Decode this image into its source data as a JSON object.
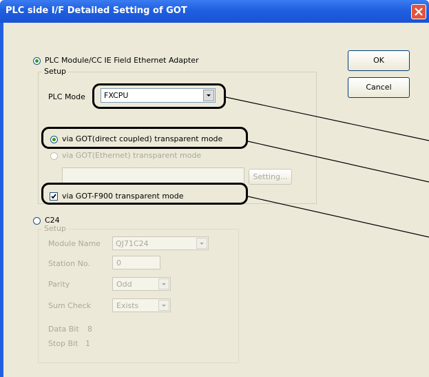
{
  "window": {
    "title": "PLC side I/F Detailed Setting of GOT"
  },
  "buttons": {
    "ok": "OK",
    "cancel": "Cancel"
  },
  "plc_module": {
    "radio_label": "PLC Module/CC IE Field Ethernet Adapter",
    "setup_label": "Setup",
    "plc_mode_label": "PLC Mode",
    "plc_mode_value": "FXCPU",
    "direct_coupled_label": "via GOT(direct coupled) transparent mode",
    "ethernet_label": "via GOT(Ethernet) transparent mode",
    "setting_button": "Setting...",
    "f900_label": "via GOT-F900 transparent mode"
  },
  "c24": {
    "radio_label": "C24",
    "setup_label": "Setup",
    "module_name_label": "Module Name",
    "module_name_value": "QJ71C24",
    "station_no_label": "Station No.",
    "station_no_value": "0",
    "parity_label": "Parity",
    "parity_value": "Odd",
    "sum_check_label": "Sum Check",
    "sum_check_value": "Exists",
    "data_bit_label": "Data Bit",
    "data_bit_value": "8",
    "stop_bit_label": "Stop Bit",
    "stop_bit_value": "1"
  },
  "colors": {
    "title_bar": "#1f5fe0",
    "dialog_bg": "#ece9d8",
    "accent_check": "#21a121",
    "close_button": "#e1553f"
  }
}
